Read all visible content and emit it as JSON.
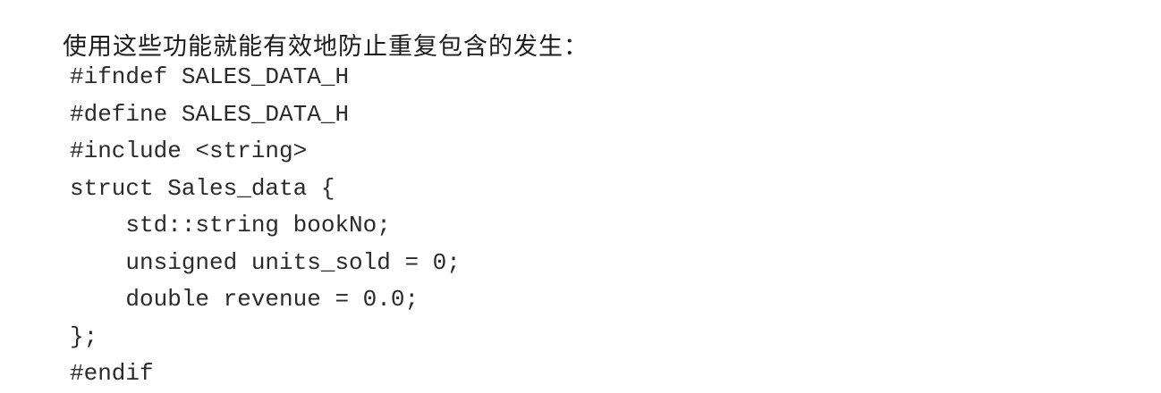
{
  "document": {
    "intro_text": "使用这些功能就能有效地防止重复包含的发生：",
    "code_lines": [
      "#ifndef SALES_DATA_H",
      "#define SALES_DATA_H",
      "#include <string>",
      "struct Sales_data {",
      "    std::string bookNo;",
      "    unsigned units_sold = 0;",
      "    double revenue = 0.0;",
      "};",
      "#endif"
    ]
  }
}
